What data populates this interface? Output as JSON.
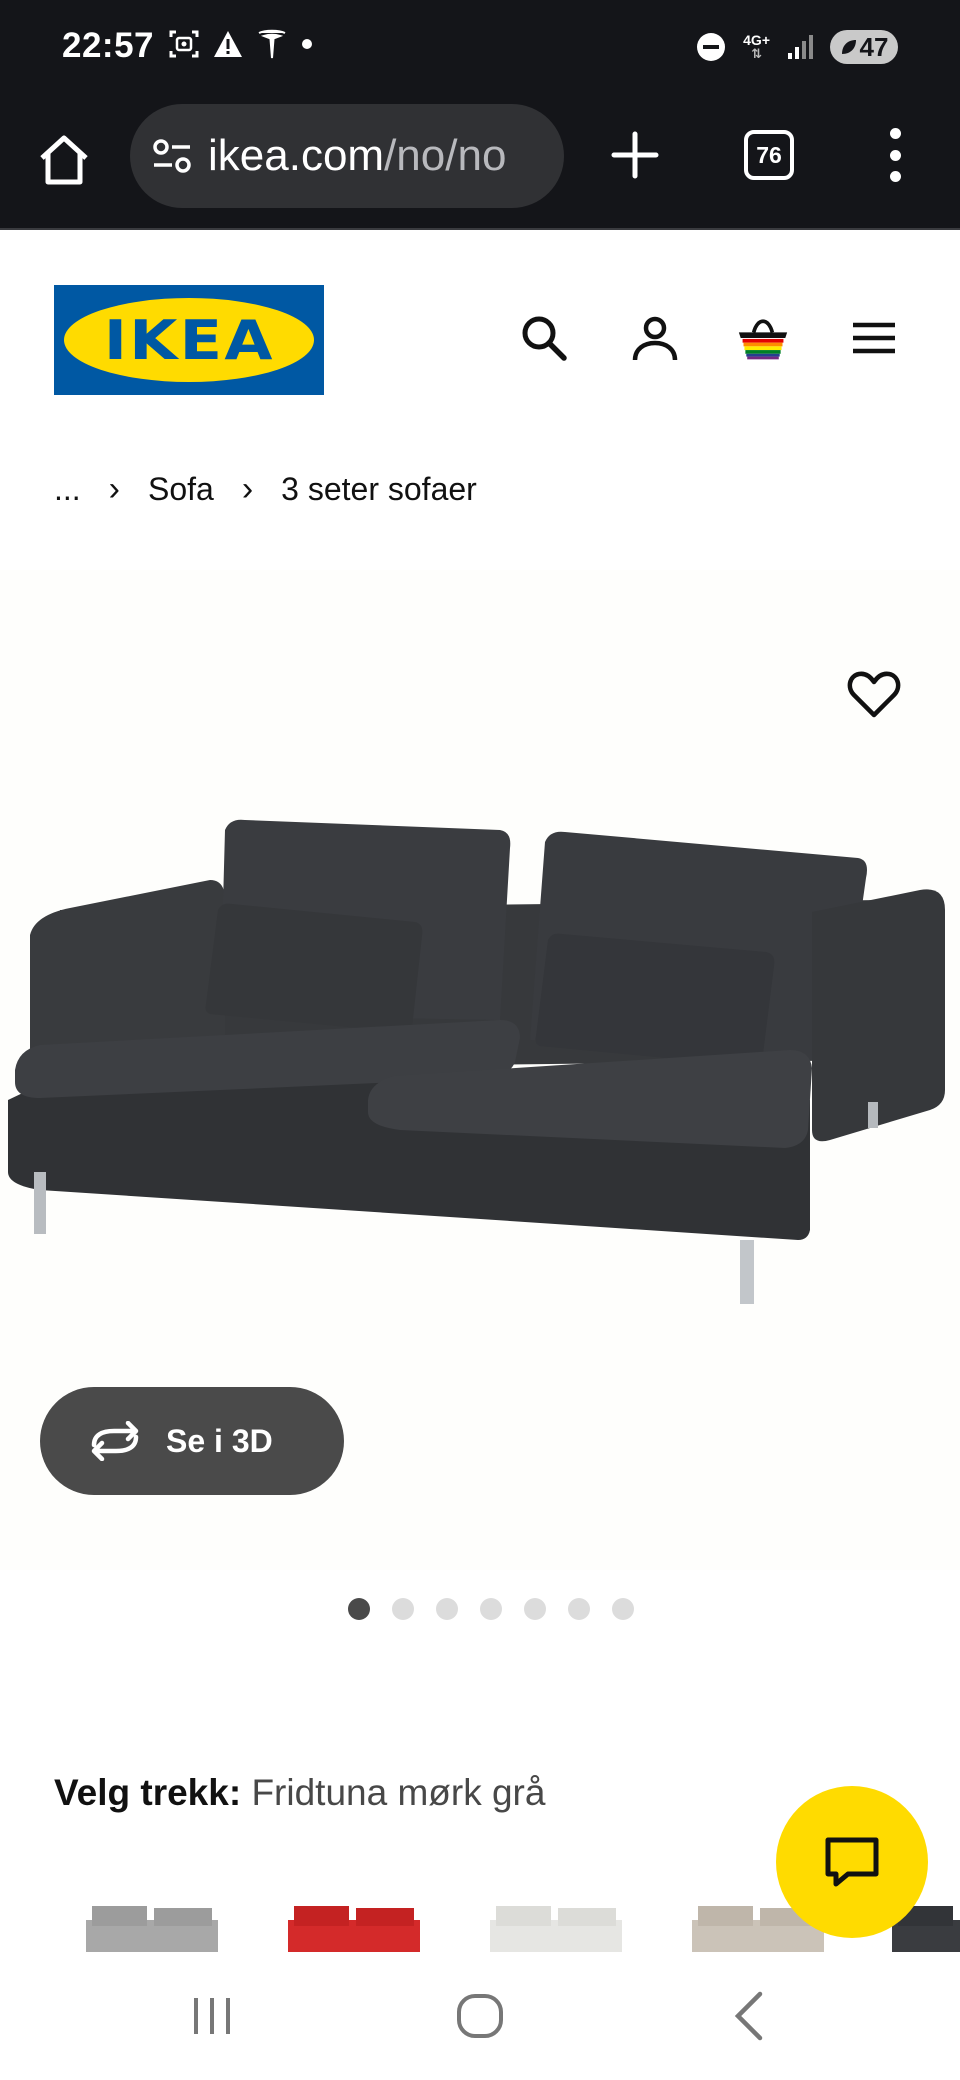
{
  "status_bar": {
    "time": "22:57",
    "left_icons": [
      "screenshot-icon",
      "warning-icon",
      "tesla-icon",
      "dot-icon"
    ],
    "network": "4G+",
    "battery": "47"
  },
  "browser": {
    "url_host": "ikea.com",
    "url_path": "/no/no",
    "tab_count": "76"
  },
  "header": {
    "logo_text": "IKEA",
    "icons": [
      "search-icon",
      "account-icon",
      "cart-icon",
      "menu-icon"
    ]
  },
  "breadcrumb": {
    "ellipsis": "...",
    "items": [
      "Sofa",
      "3 seter sofaer"
    ]
  },
  "product": {
    "view_3d_label": "Se i 3D",
    "image_count": 7,
    "active_image": 1
  },
  "cover": {
    "label": "Velg trekk:",
    "value": "Fridtuna mørk grå",
    "swatch_colors": [
      "#a8a8a8",
      "#d42a2a",
      "#e6e6e3",
      "#cbc3b8",
      "#3a3c40"
    ]
  },
  "colors": {
    "ikea_blue": "#0058a3",
    "ikea_yellow": "#ffdb00",
    "sofa_color": "#3b3d40"
  }
}
